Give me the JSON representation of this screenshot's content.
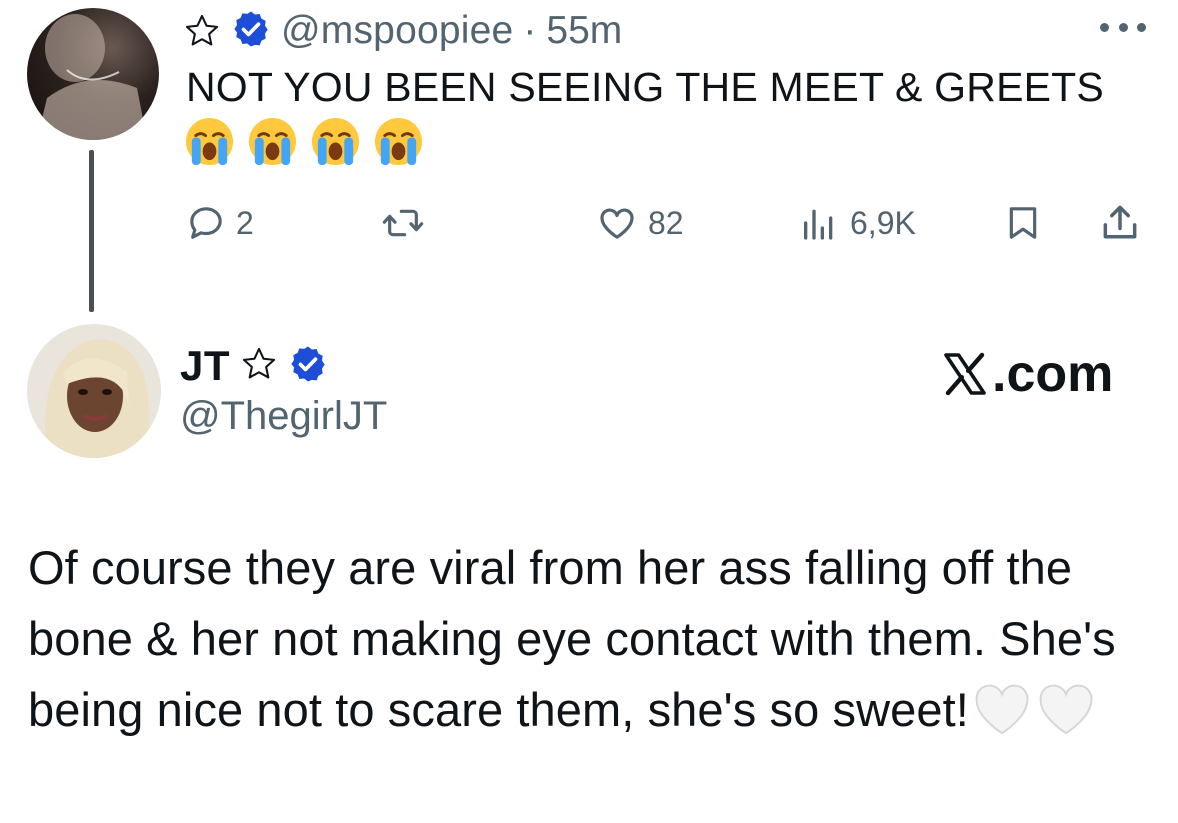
{
  "tweet1": {
    "handle": "@mspoopiee",
    "separator": "·",
    "time": "55m",
    "text": "NOT YOU BEEN SEEING THE MEET & GREETS",
    "emojis": [
      "loudly-crying-face",
      "loudly-crying-face",
      "loudly-crying-face",
      "loudly-crying-face"
    ],
    "actions": {
      "replies": "2",
      "retweets": "",
      "likes": "82",
      "views": "6,9K"
    }
  },
  "tweet2": {
    "name": "JT",
    "handle": "@ThegirlJT",
    "source": ".com",
    "text": "Of course they are viral from her ass falling off the bone & her not making eye contact with them. She's being nice not to scare them, she's so sweet!",
    "trailing_emojis": [
      "white-heart",
      "white-heart"
    ]
  },
  "colors": {
    "verified": "#1d4ed8",
    "muted": "#536471",
    "text": "#0f1419"
  }
}
